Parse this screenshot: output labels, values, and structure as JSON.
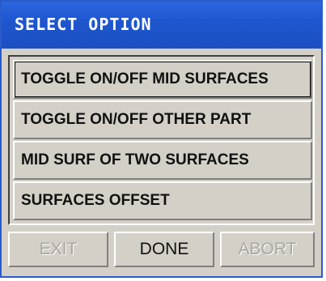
{
  "window": {
    "title": "SELECT OPTION"
  },
  "options": [
    {
      "label": "TOGGLE ON/OFF MID SURFACES"
    },
    {
      "label": "TOGGLE ON/OFF OTHER PART"
    },
    {
      "label": "MID SURF OF TWO SURFACES"
    },
    {
      "label": "SURFACES OFFSET"
    }
  ],
  "buttons": {
    "exit": {
      "label": "EXIT",
      "enabled": false
    },
    "done": {
      "label": "DONE",
      "enabled": true
    },
    "abort": {
      "label": "ABORT",
      "enabled": false
    }
  },
  "colors": {
    "titlebar": "#1e56cf",
    "title_text": "#ffffff",
    "panel_bg": "#d4d0c8",
    "disabled_text": "#a8a6a0"
  }
}
